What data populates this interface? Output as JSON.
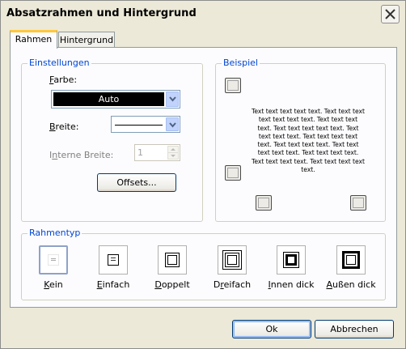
{
  "window": {
    "title": "Absatzrahmen und Hintergrund"
  },
  "tabs": [
    {
      "label": "Rahmen",
      "active": true
    },
    {
      "label": "Hintergrund",
      "active": false
    }
  ],
  "settings": {
    "group_label": "Einstellungen",
    "color_label_accel": "F",
    "color_label_rest": "arbe:",
    "color_value": "Auto",
    "width_label_accel": "B",
    "width_label_rest": "reite:",
    "internal_width_label_pre": "I",
    "internal_width_label_accel": "n",
    "internal_width_label_rest": "terne Breite:",
    "internal_width_value": "1",
    "offsets_button": "Offsets..."
  },
  "example": {
    "group_label": "Beispiel",
    "sample_text": "Text text text text text. Text text text text text text text. Text text text text. Text text text text text. Text text text text. Text text text text text. Text text text text. Text text text text text. Text text text text. Text text text text. Text text text text text."
  },
  "frametype": {
    "group_label": "Rahmentyp",
    "items": [
      {
        "accel": "K",
        "rest": "ein",
        "pre": ""
      },
      {
        "accel": "E",
        "rest": "infach",
        "pre": ""
      },
      {
        "accel": "D",
        "rest": "oppelt",
        "pre": ""
      },
      {
        "accel": "r",
        "rest": "eifach",
        "pre": "D"
      },
      {
        "accel": "I",
        "rest": "nnen dick",
        "pre": ""
      },
      {
        "accel": "A",
        "rest": "ußen dick",
        "pre": ""
      }
    ]
  },
  "buttons": {
    "ok": "Ok",
    "cancel": "Abbrechen"
  },
  "colors": {
    "accent": "#0046d5",
    "tab_highlight": "#ffc83c",
    "dialog_bg": "#ece9d8"
  }
}
